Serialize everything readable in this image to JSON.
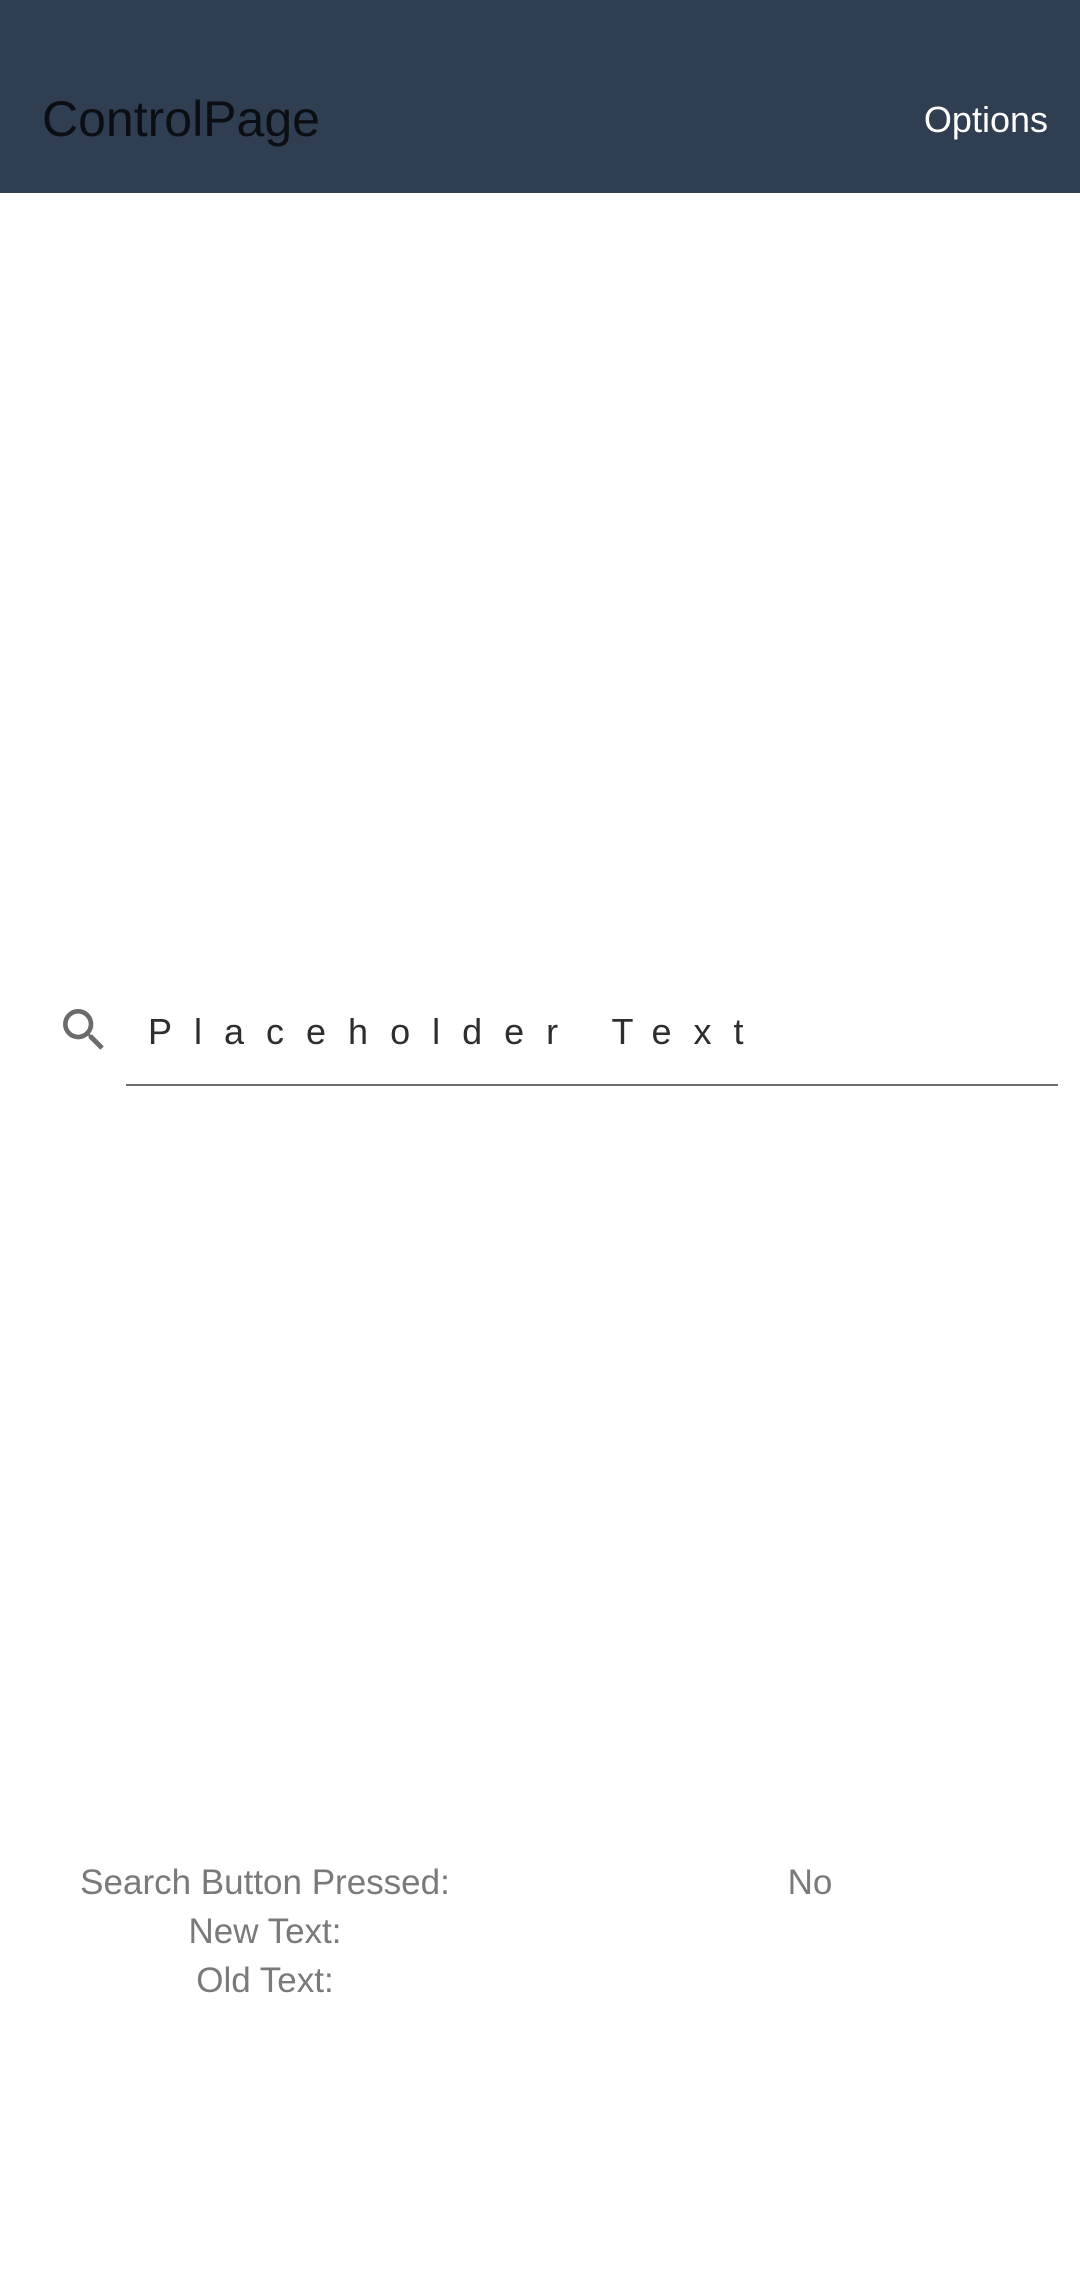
{
  "app_bar": {
    "title": "ControlPage",
    "options_label": "Options",
    "background_color": "#2f3e50"
  },
  "search": {
    "icon": "search-icon",
    "placeholder": "Placeholder Text",
    "value": ""
  },
  "status": {
    "search_pressed_label": "Search Button Pressed:",
    "search_pressed_value": "No",
    "new_text_label": "New Text:",
    "new_text_value": "",
    "old_text_label": "Old Text:",
    "old_text_value": ""
  }
}
